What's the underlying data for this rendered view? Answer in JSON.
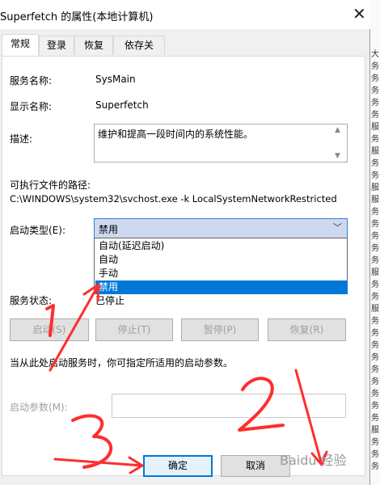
{
  "window": {
    "title": "Superfetch 的属性(本地计算机)",
    "close_glyph": "✕"
  },
  "tabs": [
    {
      "label": "常规",
      "active": true
    },
    {
      "label": "登录",
      "active": false
    },
    {
      "label": "恢复",
      "active": false
    },
    {
      "label": "依存关系",
      "active": false
    }
  ],
  "general": {
    "service_name_label": "服务名称:",
    "service_name_value": "SysMain",
    "display_name_label": "显示名称:",
    "display_name_value": "Superfetch",
    "description_label": "描述:",
    "description_value": "维护和提高一段时间内的系统性能。",
    "path_label": "可执行文件的路径:",
    "path_value": "C:\\WINDOWS\\system32\\svchost.exe -k LocalSystemNetworkRestricted",
    "startup_type_label": "启动类型(E):",
    "startup_type_value": "禁用",
    "startup_options": [
      "自动(延迟启动)",
      "自动",
      "手动",
      "禁用"
    ],
    "status_label": "服务状态:",
    "status_value": "已停止",
    "buttons": {
      "start": "启动(S)",
      "stop": "停止(T)",
      "pause": "暂停(P)",
      "resume": "恢复(R)"
    },
    "hint": "当从此处启动服务时，你可指定所适用的启动参数。",
    "params_label": "启动参数(M):",
    "params_value": ""
  },
  "footer": {
    "ok": "确定",
    "cancel": "取消"
  },
  "background_chars": [
    "大",
    "务",
    "务",
    "务",
    "务",
    "务",
    "服",
    "务",
    "服",
    "务",
    "务",
    "服",
    "服",
    "务",
    "务",
    "务",
    "务",
    "务",
    "服",
    "务",
    "务",
    "服",
    "务",
    "务",
    "务",
    "务",
    "务",
    "务",
    "务",
    "务",
    "务",
    "服",
    "务",
    "务",
    "务"
  ],
  "annotations": {
    "markers": [
      "1",
      "2",
      "3"
    ],
    "arrow_color": "#ff2d2d"
  },
  "watermark": "Baidu 经验"
}
